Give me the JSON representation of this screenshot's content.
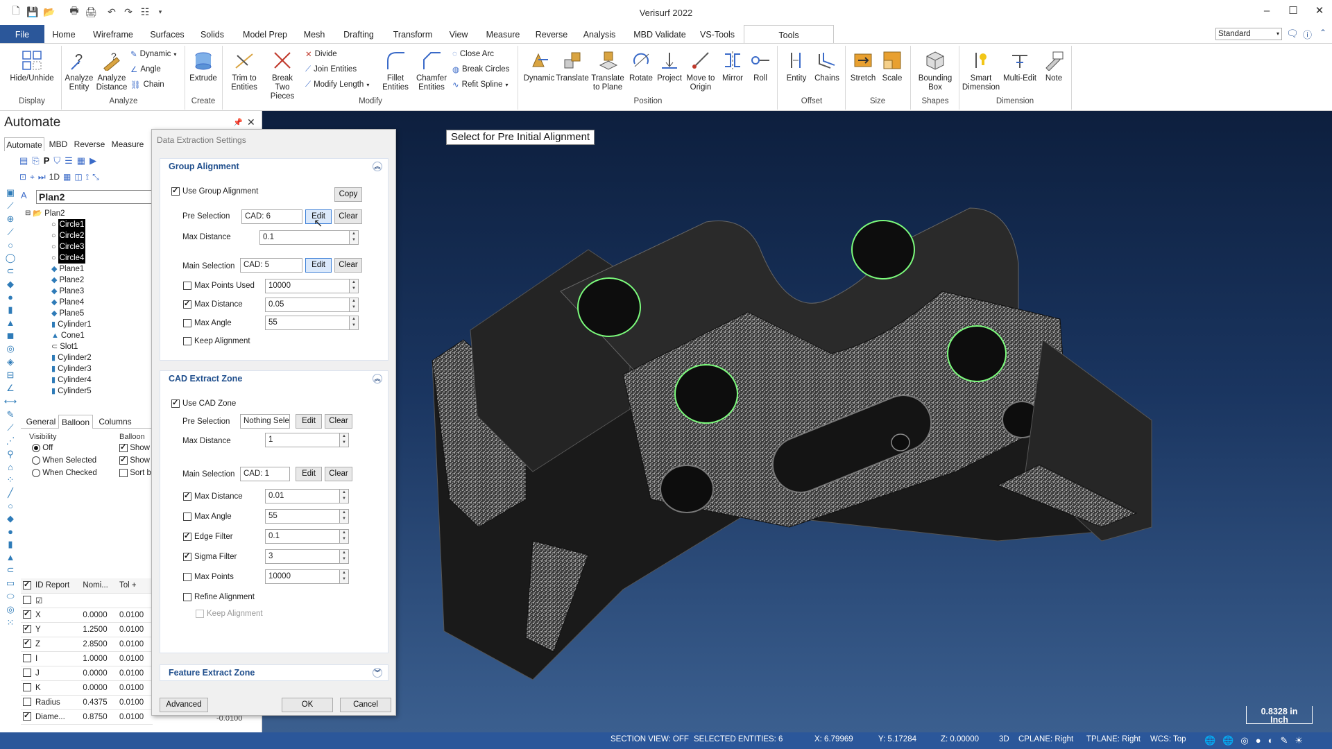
{
  "app": {
    "title": "Verisurf 2022"
  },
  "ribbon_tabs": [
    "File",
    "Home",
    "Wireframe",
    "Surfaces",
    "Solids",
    "Model Prep",
    "Mesh",
    "Drafting",
    "Transform",
    "View",
    "Measure",
    "Reverse",
    "Analysis",
    "MBD Validate",
    "VS-Tools",
    "Tools"
  ],
  "style_combo": "Standard",
  "ribbon": {
    "display": {
      "hide": "Hide/Unhide",
      "group": "Display"
    },
    "analyze": {
      "entity": "Analyze Entity",
      "distance": "Analyze Distance",
      "dynamic": "Dynamic",
      "angle": "Angle",
      "chain": "Chain",
      "group": "Analyze"
    },
    "create": {
      "extrude": "Extrude",
      "group": "Create"
    },
    "modify": {
      "trim": "Trim to Entities",
      "break2": "Break Two Pieces",
      "divide": "Divide",
      "join": "Join Entities",
      "modlen": "Modify Length",
      "fillet": "Fillet Entities",
      "chamfer": "Chamfer Entities",
      "closearc": "Close Arc",
      "breakcircles": "Break Circles",
      "refit": "Refit Spline",
      "group": "Modify"
    },
    "position": {
      "dynamic": "Dynamic",
      "translate": "Translate",
      "tplane": "Translate to Plane",
      "rotate": "Rotate",
      "project": "Project",
      "origin": "Move to Origin",
      "mirror": "Mirror",
      "roll": "Roll",
      "group": "Position"
    },
    "offset": {
      "entity": "Entity",
      "chains": "Chains",
      "group": "Offset"
    },
    "size": {
      "stretch": "Stretch",
      "scale": "Scale",
      "group": "Size"
    },
    "shapes": {
      "bbox": "Bounding Box",
      "group": "Shapes"
    },
    "dimension": {
      "smart": "Smart Dimension",
      "multi": "Multi-Edit",
      "note": "Note",
      "group": "Dimension"
    }
  },
  "left_panel": {
    "title": "Automate",
    "tabs": [
      "Automate",
      "MBD",
      "Reverse",
      "Measure"
    ],
    "plan_name": "Plan2",
    "tree": [
      {
        "label": "Plan2",
        "icon": "folder-icon",
        "selected": false
      },
      {
        "label": "Circle1",
        "icon": "circle-icon",
        "selected": true
      },
      {
        "label": "Circle2",
        "icon": "circle-icon",
        "selected": true
      },
      {
        "label": "Circle3",
        "icon": "circle-icon",
        "selected": true
      },
      {
        "label": "Circle4",
        "icon": "circle-icon",
        "selected": true
      },
      {
        "label": "Plane1",
        "icon": "plane-icon",
        "selected": false
      },
      {
        "label": "Plane2",
        "icon": "plane-icon",
        "selected": false
      },
      {
        "label": "Plane3",
        "icon": "plane-icon",
        "selected": false
      },
      {
        "label": "Plane4",
        "icon": "plane-icon",
        "selected": false
      },
      {
        "label": "Plane5",
        "icon": "plane-icon",
        "selected": false
      },
      {
        "label": "Cylinder1",
        "icon": "cylinder-icon",
        "selected": false
      },
      {
        "label": "Cone1",
        "icon": "cone-icon",
        "selected": false
      },
      {
        "label": "Slot1",
        "icon": "slot-icon",
        "selected": false
      },
      {
        "label": "Cylinder2",
        "icon": "cylinder-icon",
        "selected": false
      },
      {
        "label": "Cylinder3",
        "icon": "cylinder-icon",
        "selected": false
      },
      {
        "label": "Cylinder4",
        "icon": "cylinder-icon",
        "selected": false
      },
      {
        "label": "Cylinder5",
        "icon": "cylinder-icon",
        "selected": false
      }
    ],
    "prop_tabs": [
      "General",
      "Balloon",
      "Columns"
    ],
    "visibility_label": "Visibility",
    "visibility_options": [
      "Off",
      "When Selected",
      "When Checked"
    ],
    "balloon_label": "Balloon",
    "balloon_options": [
      "Show N",
      "Show N",
      "Sort by"
    ],
    "grid_headers": [
      "ID",
      "Report",
      "Nomi...",
      "Tol +"
    ],
    "grid_rows": [
      {
        "name": "X",
        "nominal": "0.0000",
        "tol": "0.0100",
        "checked": true
      },
      {
        "name": "Y",
        "nominal": "1.2500",
        "tol": "0.0100",
        "checked": true
      },
      {
        "name": "Z",
        "nominal": "2.8500",
        "tol": "0.0100",
        "checked": true
      },
      {
        "name": "I",
        "nominal": "1.0000",
        "tol": "0.0100",
        "checked": false
      },
      {
        "name": "J",
        "nominal": "0.0000",
        "tol": "0.0100",
        "checked": false
      },
      {
        "name": "K",
        "nominal": "0.0000",
        "tol": "0.0100",
        "checked": false
      },
      {
        "name": "Radius",
        "nominal": "0.4375",
        "tol": "0.0100",
        "checked": false
      },
      {
        "name": "Diame...",
        "nominal": "0.8750",
        "tol": "0.0100",
        "checked": true
      }
    ],
    "tol_minus": "-0.0100"
  },
  "dialog": {
    "title": "Data Extraction Settings",
    "group_alignment": {
      "header": "Group Alignment",
      "use_label": "Use Group Alignment",
      "use_checked": true,
      "copy": "Copy",
      "pre_label": "Pre Selection",
      "pre_value": "CAD: 6",
      "edit": "Edit",
      "clear": "Clear",
      "maxdist_label": "Max Distance",
      "maxdist_value": "0.1",
      "main_label": "Main Selection",
      "main_value": "CAD: 5",
      "maxpts_label": "Max Points Used",
      "maxpts_value": "10000",
      "maxpts_checked": false,
      "md2_label": "Max Distance",
      "md2_value": "0.05",
      "md2_checked": true,
      "maxang_label": "Max Angle",
      "maxang_value": "55",
      "maxang_checked": false,
      "keep_label": "Keep Alignment",
      "keep_checked": false
    },
    "cad_zone": {
      "header": "CAD Extract Zone",
      "use_label": "Use CAD Zone",
      "use_checked": true,
      "pre_label": "Pre Selection",
      "pre_value": "Nothing Selec",
      "maxdist_label": "Max Distance",
      "maxdist_value": "1",
      "main_label": "Main Selection",
      "main_value": "CAD: 1",
      "md2_label": "Max Distance",
      "md2_value": "0.01",
      "md2_checked": true,
      "maxang_label": "Max Angle",
      "maxang_value": "55",
      "maxang_checked": false,
      "edge_label": "Edge Filter",
      "edge_value": "0.1",
      "edge_checked": true,
      "sigma_label": "Sigma Filter",
      "sigma_value": "3",
      "sigma_checked": true,
      "maxpts_label": "Max Points",
      "maxpts_value": "10000",
      "maxpts_checked": false,
      "refine_label": "Refine Alignment",
      "refine_checked": false,
      "keep_label": "Keep Alignment"
    },
    "feature_zone": {
      "header": "Feature Extract Zone"
    },
    "advanced": "Advanced",
    "ok": "OK",
    "cancel": "Cancel"
  },
  "viewport": {
    "prompt": "Select for Pre Initial Alignment",
    "scale_value": "0.8328 in",
    "scale_unit": "Inch"
  },
  "status": {
    "section_view": "SECTION VIEW: OFF",
    "selected": "SELECTED ENTITIES: 6",
    "x": "X:   6.79969",
    "y": "Y:   5.17284",
    "z": "Z:   0.00000",
    "mode": "3D",
    "cplane": "CPLANE: Right",
    "tplane": "TPLANE: Right",
    "wcs": "WCS: Top"
  }
}
